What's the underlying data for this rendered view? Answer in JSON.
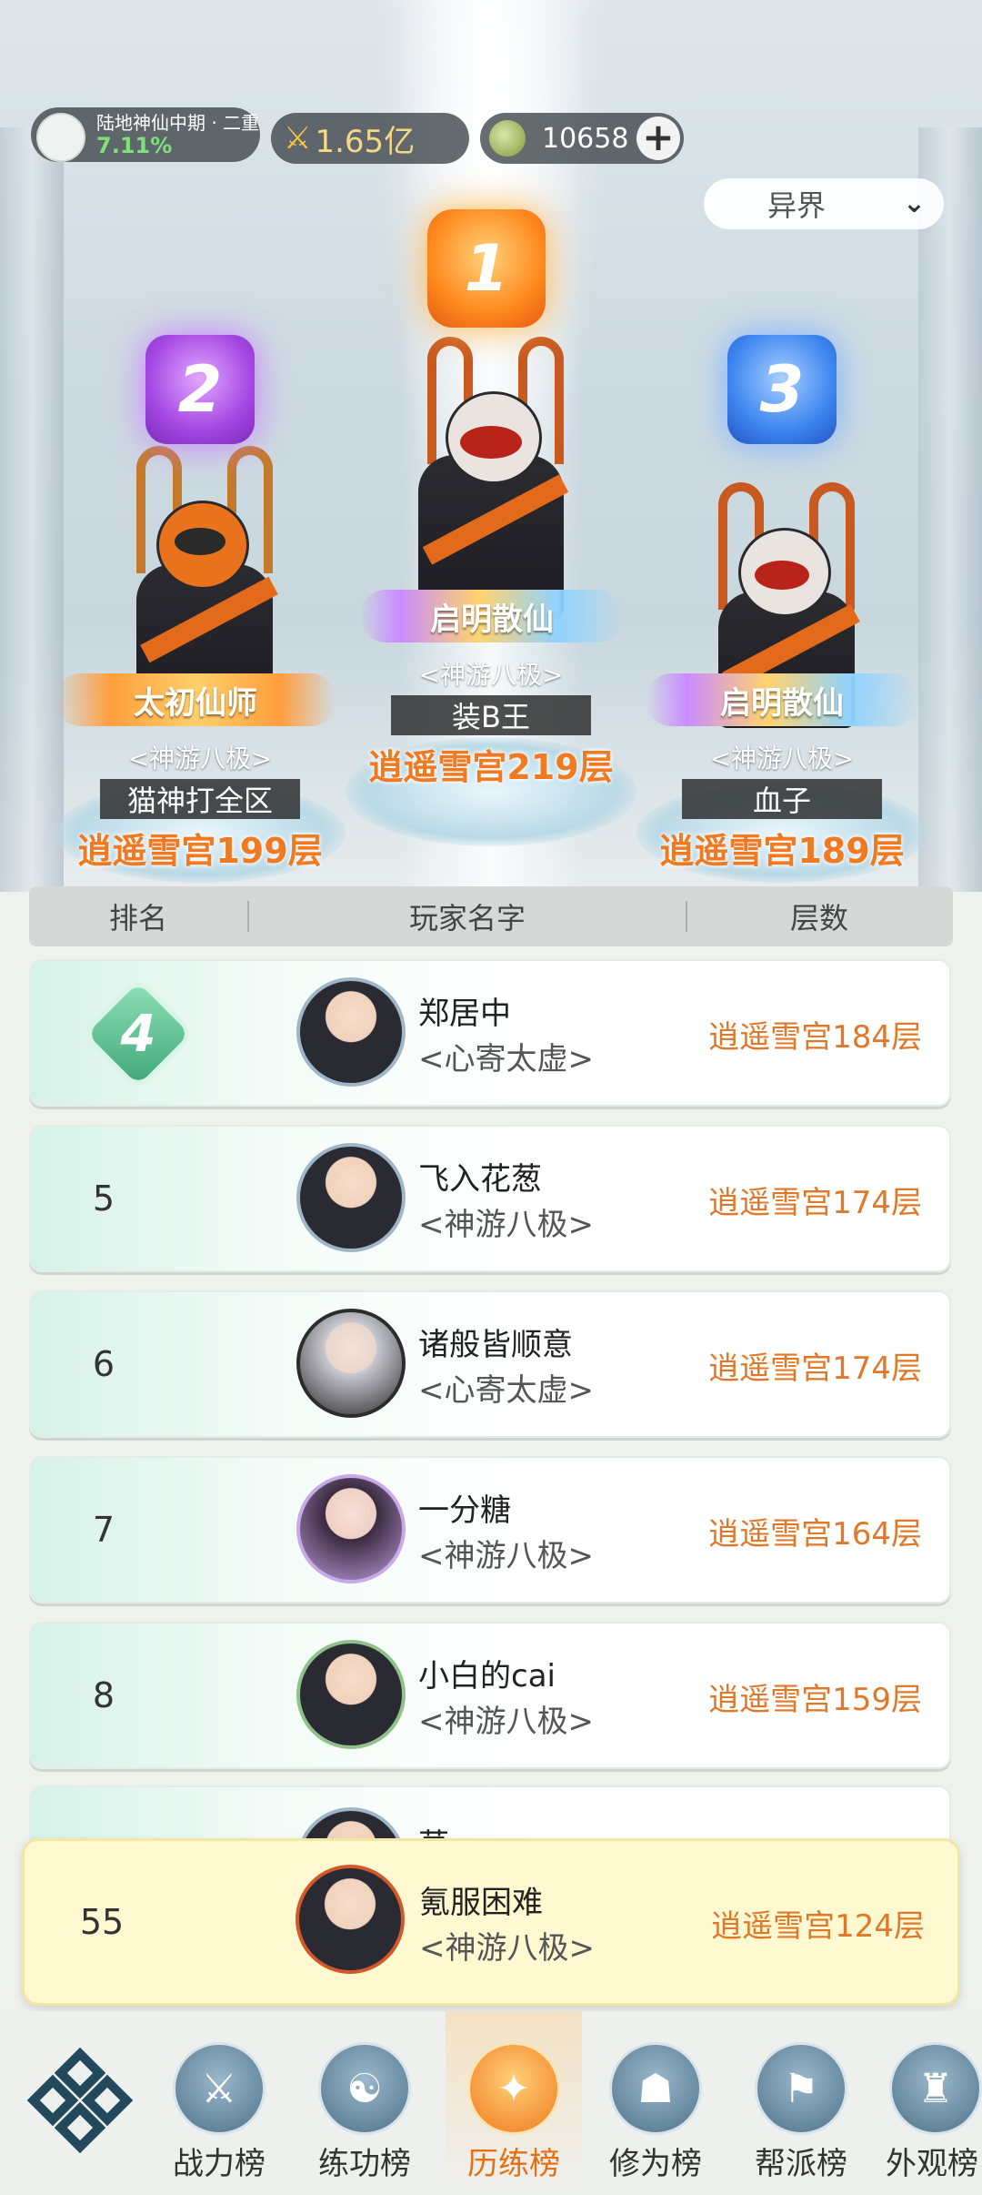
{
  "header": {
    "level_title": "陆地神仙中期 · 二重",
    "level_percent": "7.11%",
    "power_value": "1.65亿",
    "coin_value": "10658",
    "plus_label": "+",
    "realm_select": "异界",
    "power_icon": "crossed-swords-icon",
    "coin_icon": "jade-coin-icon"
  },
  "podium": [
    {
      "rank": "1",
      "title": "启明散仙",
      "sect": "<神游八极>",
      "name": "装B王",
      "score": "逍遥雪宫219层"
    },
    {
      "rank": "2",
      "title": "太初仙师",
      "sect": "<神游八极>",
      "name": "猫神打全区",
      "score": "逍遥雪宫199层"
    },
    {
      "rank": "3",
      "title": "启明散仙",
      "sect": "<神游八极>",
      "name": "血子",
      "score": "逍遥雪宫189层"
    }
  ],
  "table": {
    "columns": [
      "排名",
      "玩家名字",
      "层数"
    ],
    "rows": [
      {
        "rank": "4",
        "name": "郑居中",
        "sect": "<心寄太虚>",
        "score": "逍遥雪宫184层"
      },
      {
        "rank": "5",
        "name": "飞入花葱",
        "sect": "<神游八极>",
        "score": "逍遥雪宫174层"
      },
      {
        "rank": "6",
        "name": "诸般皆顺意",
        "sect": "<心寄太虚>",
        "score": "逍遥雪宫174层"
      },
      {
        "rank": "7",
        "name": "一分糖",
        "sect": "<神游八极>",
        "score": "逍遥雪宫164层"
      },
      {
        "rank": "8",
        "name": "小白的cai",
        "sect": "<神游八极>",
        "score": "逍遥雪宫159层"
      }
    ],
    "partial_row_name": "莫"
  },
  "my_rank": {
    "rank": "55",
    "name": "氪服困难",
    "sect": "<神游八极>",
    "score": "逍遥雪宫124层"
  },
  "nav": {
    "items": [
      {
        "label": "战力榜",
        "icon": "swords-icon"
      },
      {
        "label": "练功榜",
        "icon": "yin-yang-icon"
      },
      {
        "label": "历练榜",
        "icon": "star-icon"
      },
      {
        "label": "修为榜",
        "icon": "hat-icon"
      },
      {
        "label": "帮派榜",
        "icon": "banner-icon"
      },
      {
        "label": "外观榜",
        "icon": "armor-icon"
      }
    ],
    "active": "历练榜"
  },
  "colors": {
    "accent_orange": "#e0782a",
    "rank4_green": "#3fa77a",
    "my_row_bg": "#fff9d2"
  }
}
